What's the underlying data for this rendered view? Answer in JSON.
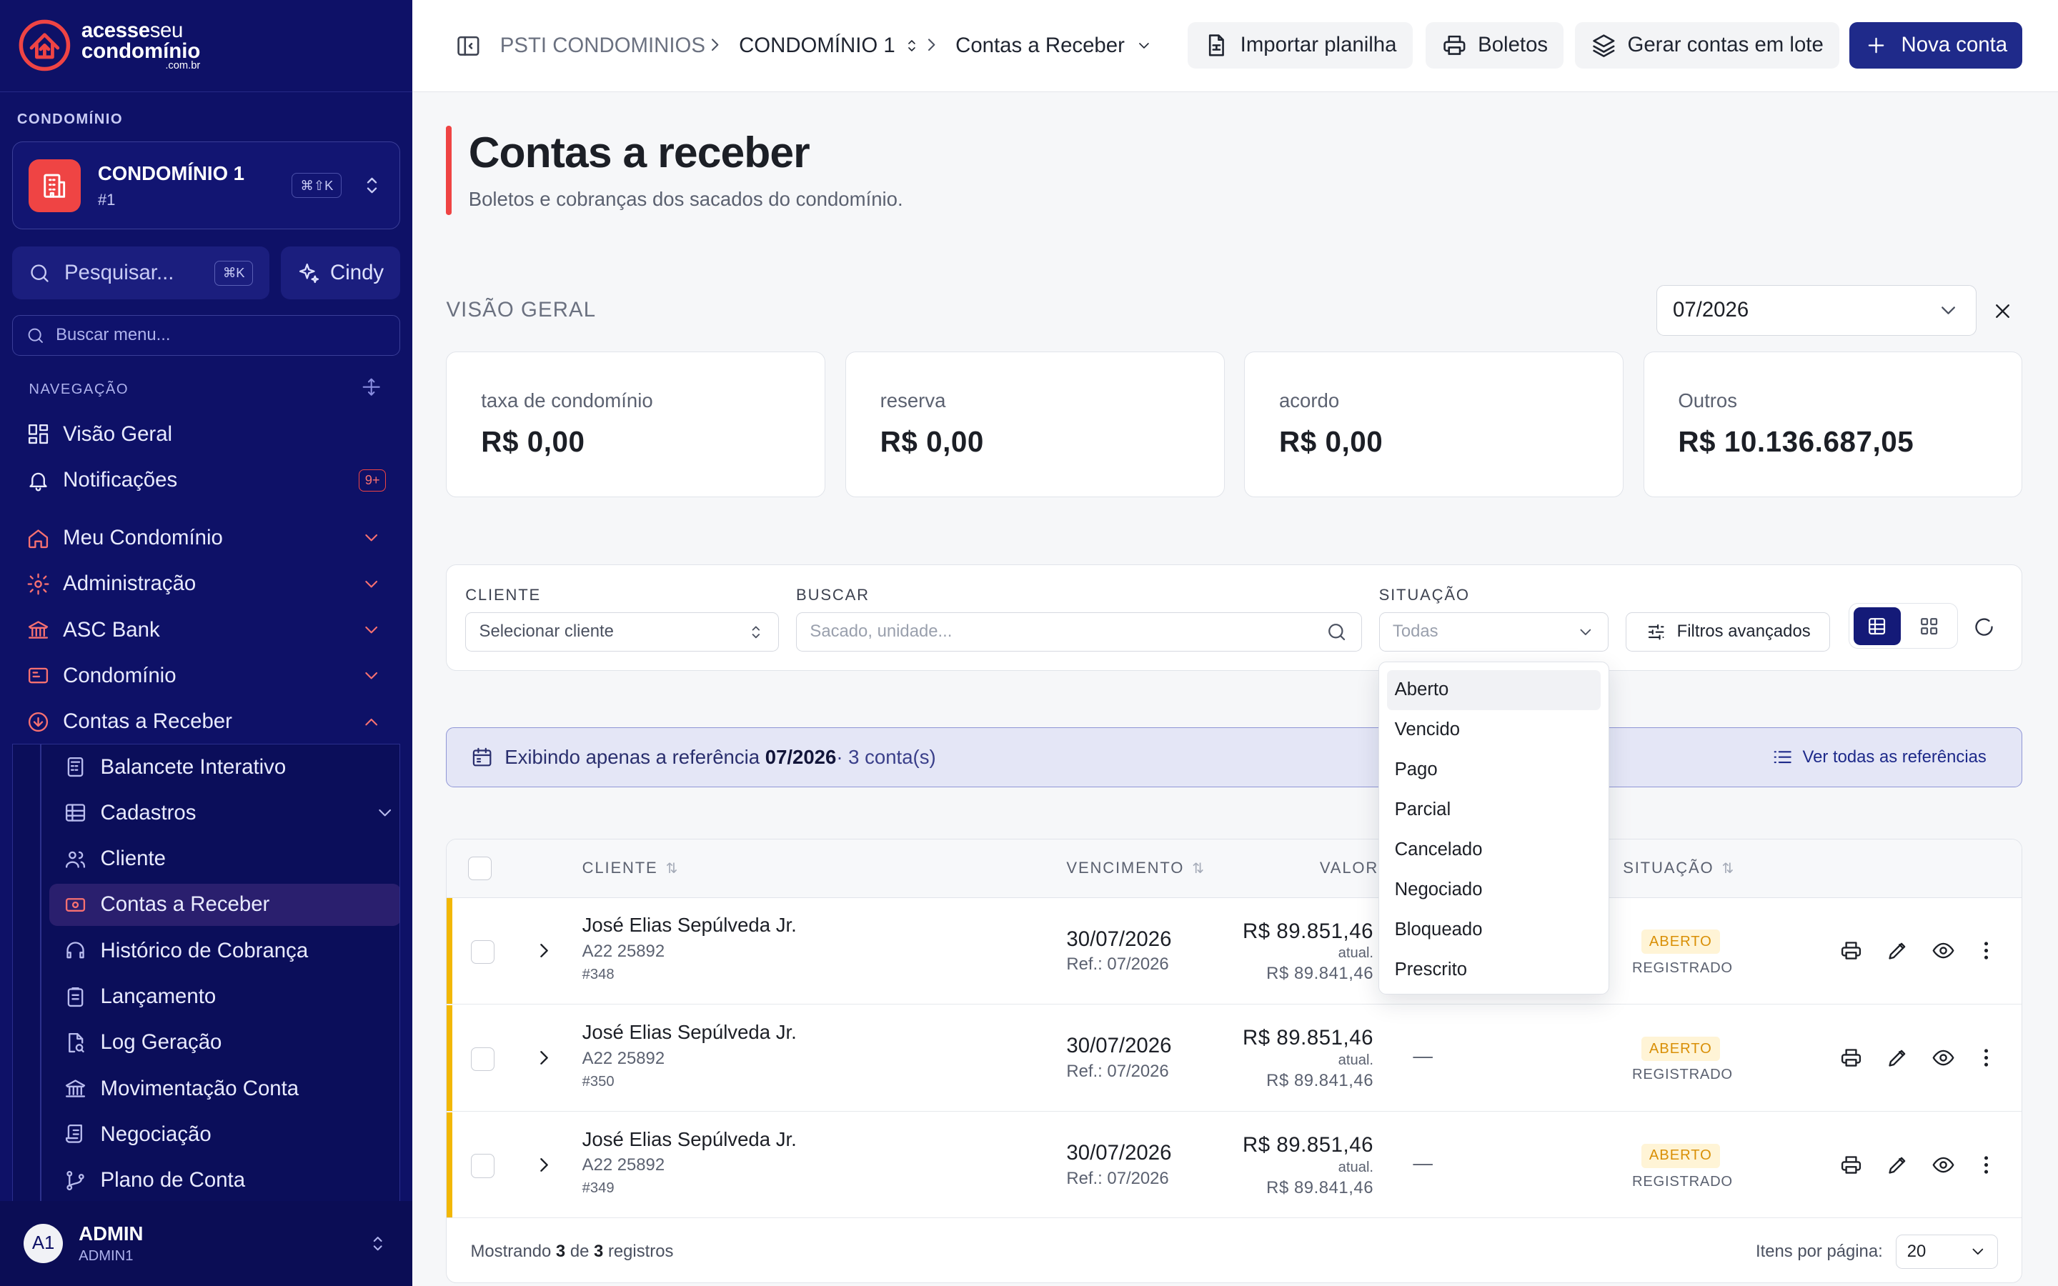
{
  "brand": {
    "line1a": "acesse",
    "line1b": "seu",
    "line2": "condomínio",
    "line3": ".com.br"
  },
  "sidebar": {
    "condo_section_label": "CONDOMÍNIO",
    "condo_name": "CONDOMÍNIO 1",
    "condo_id": "#1",
    "condo_shortcut": "⌘⇧K",
    "search_placeholder": "Pesquisar...",
    "search_shortcut": "⌘K",
    "assistant_label": "Cindy",
    "menu_search_placeholder": "Buscar menu...",
    "nav_title": "NAVEGAÇÃO",
    "items": [
      {
        "label": "Visão Geral"
      },
      {
        "label": "Notificações",
        "badge": "9+"
      },
      {
        "label": "Meu Condomínio"
      },
      {
        "label": "Administração"
      },
      {
        "label": "ASC Bank"
      },
      {
        "label": "Condomínio"
      },
      {
        "label": "Contas a Receber"
      }
    ],
    "subitems": [
      {
        "label": "Balancete Interativo"
      },
      {
        "label": "Cadastros"
      },
      {
        "label": "Cliente"
      },
      {
        "label": "Contas a Receber"
      },
      {
        "label": "Histórico de Cobrança"
      },
      {
        "label": "Lançamento"
      },
      {
        "label": "Log Geração"
      },
      {
        "label": "Movimentação Conta"
      },
      {
        "label": "Negociação"
      },
      {
        "label": "Plano de Conta"
      }
    ],
    "user": {
      "initials": "A1",
      "name": "ADMIN",
      "login": "ADMIN1"
    }
  },
  "topbar": {
    "breadcrumb": [
      "PSTI CONDOMINIOS",
      "CONDOMÍNIO 1",
      "Contas a Receber"
    ],
    "import_label": "Importar planilha",
    "boletos_label": "Boletos",
    "batch_label": "Gerar contas em lote",
    "new_label": "Nova conta"
  },
  "page": {
    "title": "Contas a receber",
    "subtitle": "Boletos e cobranças dos sacados do condomínio.",
    "overview_label": "VISÃO GERAL",
    "reference_month": "07/2026"
  },
  "cards": [
    {
      "label": "taxa de condomínio",
      "value": "R$ 0,00"
    },
    {
      "label": "reserva",
      "value": "R$ 0,00"
    },
    {
      "label": "acordo",
      "value": "R$ 0,00"
    },
    {
      "label": "Outros",
      "value": "R$ 10.136.687,05"
    }
  ],
  "filters": {
    "client_label": "CLIENTE",
    "client_placeholder": "Selecionar cliente",
    "search_label": "BUSCAR",
    "search_placeholder": "Sacado, unidade...",
    "status_label": "SITUAÇÃO",
    "status_value": "Todas",
    "advanced_label": "Filtros avançados"
  },
  "status_options": [
    "Aberto",
    "Vencido",
    "Pago",
    "Parcial",
    "Cancelado",
    "Negociado",
    "Bloqueado",
    "Prescrito"
  ],
  "info": {
    "prefix": "Exibindo apenas a referência",
    "ref": "07/2026",
    "count": "· 3 conta(s)",
    "all_refs": "Ver todas as referências"
  },
  "table": {
    "headers": {
      "cliente": "CLIENTE",
      "vencimento": "VENCIMENTO",
      "valor": "VALOR",
      "situacao": "SITUAÇÃO"
    },
    "rows": [
      {
        "name": "José Elias Sepúlveda Jr.",
        "unit": "A22 25892",
        "id": "#348",
        "due": "30/07/2026",
        "ref": "Ref.: 07/2026",
        "value": "R$ 89.851,46",
        "atual_label": "atual.",
        "atual": "R$ 89.841,46",
        "extra": "—",
        "status": "ABERTO",
        "sub_status": "REGISTRADO"
      },
      {
        "name": "José Elias Sepúlveda Jr.",
        "unit": "A22 25892",
        "id": "#350",
        "due": "30/07/2026",
        "ref": "Ref.: 07/2026",
        "value": "R$ 89.851,46",
        "atual_label": "atual.",
        "atual": "R$ 89.841,46",
        "extra": "—",
        "status": "ABERTO",
        "sub_status": "REGISTRADO"
      },
      {
        "name": "José Elias Sepúlveda Jr.",
        "unit": "A22 25892",
        "id": "#349",
        "due": "30/07/2026",
        "ref": "Ref.: 07/2026",
        "value": "R$ 89.851,46",
        "atual_label": "atual.",
        "atual": "R$ 89.841,46",
        "extra": "—",
        "status": "ABERTO",
        "sub_status": "REGISTRADO"
      }
    ],
    "footer": {
      "showing": "Mostrando",
      "shown": "3",
      "of": "de",
      "total": "3",
      "records": "registros",
      "per_page_label": "Itens por página:",
      "per_page": "20"
    }
  },
  "colors": {
    "sidebar": "#0e1167",
    "accent": "#1f2a8a",
    "brand_red": "#ef4444",
    "status_open": "#f2b705"
  }
}
